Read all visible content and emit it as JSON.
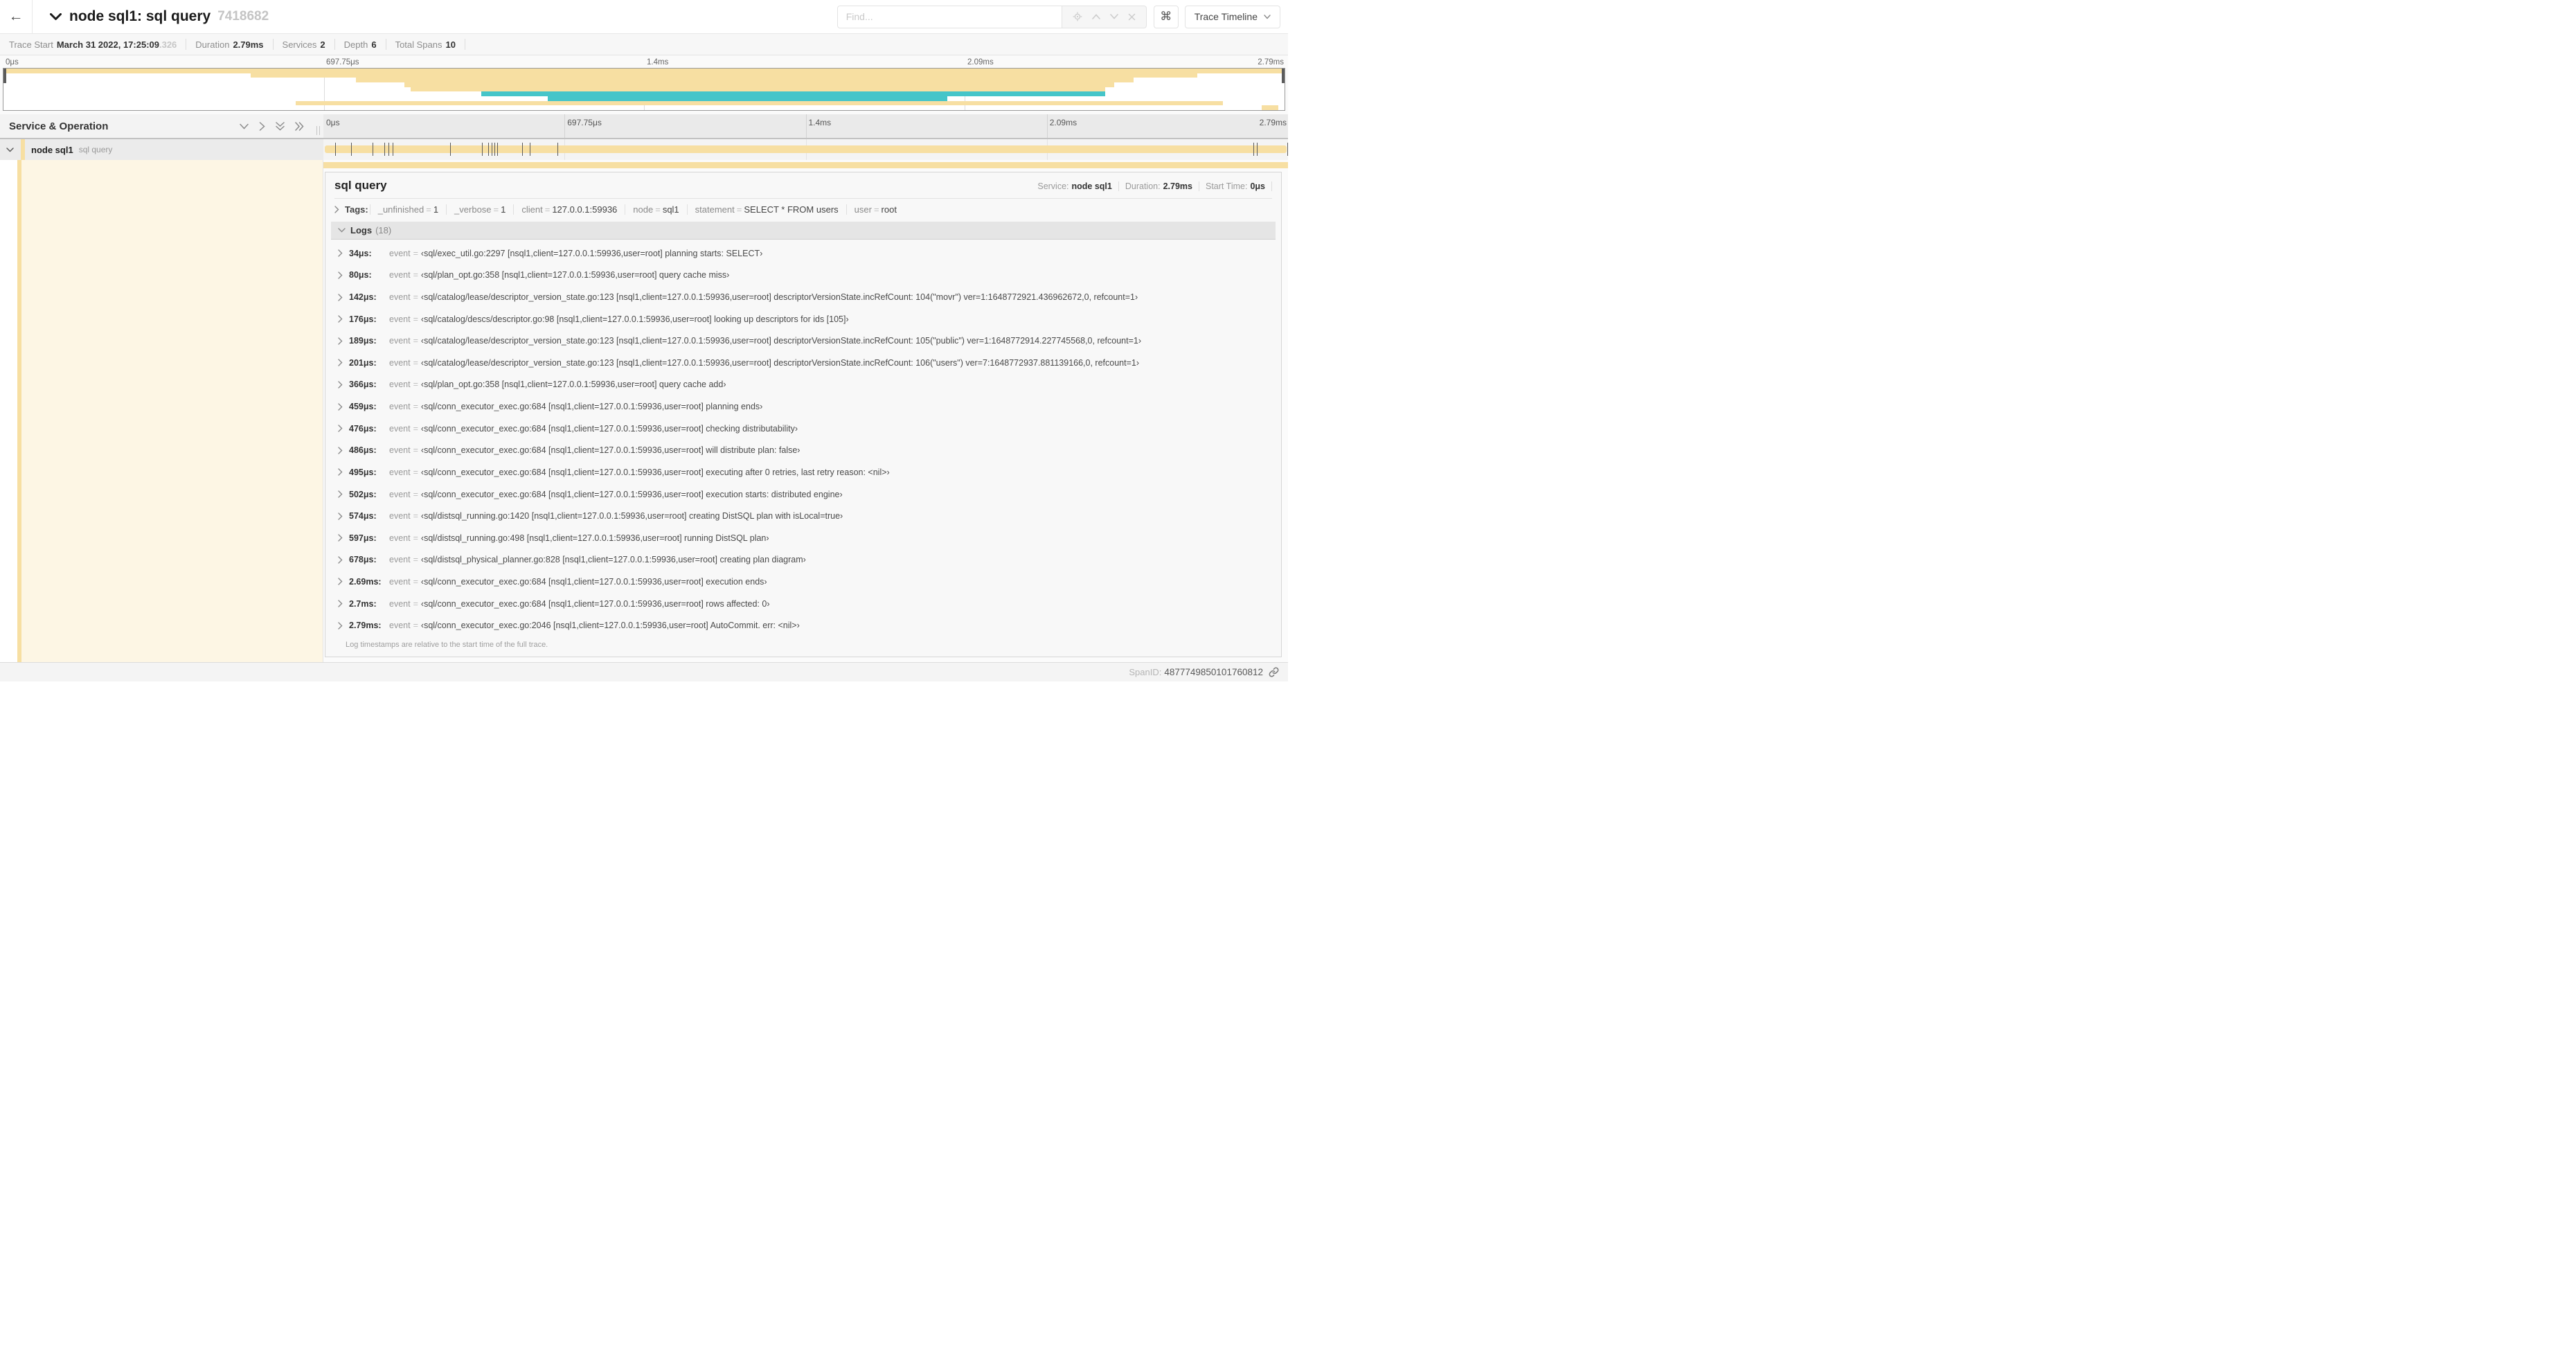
{
  "header": {
    "back_icon": "←",
    "title": "node sql1: sql query",
    "trace_id": "7418682",
    "find_placeholder": "Find...",
    "shortcut_key": "⌘",
    "view_button": "Trace Timeline"
  },
  "trace_info": [
    {
      "label": "Trace Start",
      "value": "March 31 2022, 17:25:09",
      "suffix": ".326"
    },
    {
      "label": "Duration",
      "value": "2.79ms",
      "suffix": ""
    },
    {
      "label": "Services",
      "value": "2",
      "suffix": ""
    },
    {
      "label": "Depth",
      "value": "6",
      "suffix": ""
    },
    {
      "label": "Total Spans",
      "value": "10",
      "suffix": ""
    }
  ],
  "timeline": {
    "duration_label": "2.79ms",
    "ticks": [
      {
        "label": "0μs",
        "pos": "0%",
        "align": "left"
      },
      {
        "label": "697.75μs",
        "pos": "25%",
        "align": "left"
      },
      {
        "label": "1.4ms",
        "pos": "50%",
        "align": "left"
      },
      {
        "label": "2.09ms",
        "pos": "75%",
        "align": "left"
      },
      {
        "label": "2.79ms",
        "pos": "100%",
        "align": "right"
      }
    ]
  },
  "colors": {
    "span_tan": "#f7dfa2",
    "span_teal": "#45c5c9",
    "expanded_cream": "#fdf6e4"
  },
  "minimap": {
    "bars": [
      {
        "top": "0%",
        "left": "0%",
        "width": "100%",
        "color": "#f7dfa2"
      },
      {
        "top": "11.11%",
        "left": "19.3%",
        "width": "73.9%",
        "color": "#f7dfa2"
      },
      {
        "top": "22.22%",
        "left": "27.5%",
        "width": "60.7%",
        "color": "#f7dfa2"
      },
      {
        "top": "33.33%",
        "left": "31.3%",
        "width": "55.4%",
        "color": "#f7dfa2"
      },
      {
        "top": "44.44%",
        "left": "31.8%",
        "width": "54.2%",
        "color": "#f7dfa2"
      },
      {
        "top": "55.56%",
        "left": "37.3%",
        "width": "48.7%",
        "color": "#45c5c9"
      },
      {
        "top": "66.67%",
        "left": "42.5%",
        "width": "31.2%",
        "color": "#45c5c9"
      },
      {
        "top": "77.78%",
        "left": "22.8%",
        "width": "72.4%",
        "color": "#f7dfa2"
      },
      {
        "top": "88.89%",
        "left": "98.2%",
        "width": "1.3%",
        "color": "#f7dfa2"
      }
    ]
  },
  "columns": {
    "left_header": "Service & Operation"
  },
  "span_row": {
    "service": "node sql1",
    "operation": "sql query"
  },
  "detail": {
    "operation": "sql query",
    "summary": [
      {
        "label": "Service:",
        "value": "node sql1"
      },
      {
        "label": "Duration:",
        "value": "2.79ms"
      },
      {
        "label": "Start Time:",
        "value": "0μs"
      }
    ],
    "tags_title": "Tags:",
    "tags": [
      {
        "key": "_unfinished",
        "value": "1"
      },
      {
        "key": "_verbose",
        "value": "1"
      },
      {
        "key": "client",
        "value": "127.0.0.1:59936"
      },
      {
        "key": "node",
        "value": "sql1"
      },
      {
        "key": "statement",
        "value": "SELECT * FROM users"
      },
      {
        "key": "user",
        "value": "root"
      }
    ],
    "logs_title": "Logs",
    "logs_count": "(18)",
    "logs": [
      {
        "time": "34μs:",
        "pct": "1.22%",
        "field": "event",
        "value": "‹sql/exec_util.go:2297 [nsql1,client=127.0.0.1:59936,user=root] planning starts: SELECT›"
      },
      {
        "time": "80μs:",
        "pct": "2.87%",
        "field": "event",
        "value": "‹sql/plan_opt.go:358 [nsql1,client=127.0.0.1:59936,user=root] query cache miss›"
      },
      {
        "time": "142μs:",
        "pct": "5.09%",
        "field": "event",
        "value": "‹sql/catalog/lease/descriptor_version_state.go:123 [nsql1,client=127.0.0.1:59936,user=root] descriptorVersionState.incRefCount: 104(\"movr\") ver=1:1648772921.436962672,0, refcount=1›"
      },
      {
        "time": "176μs:",
        "pct": "6.31%",
        "field": "event",
        "value": "‹sql/catalog/descs/descriptor.go:98 [nsql1,client=127.0.0.1:59936,user=root] looking up descriptors for ids [105]›"
      },
      {
        "time": "189μs:",
        "pct": "6.77%",
        "field": "event",
        "value": "‹sql/catalog/lease/descriptor_version_state.go:123 [nsql1,client=127.0.0.1:59936,user=root] descriptorVersionState.incRefCount: 105(\"public\") ver=1:1648772914.227745568,0, refcount=1›"
      },
      {
        "time": "201μs:",
        "pct": "7.20%",
        "field": "event",
        "value": "‹sql/catalog/lease/descriptor_version_state.go:123 [nsql1,client=127.0.0.1:59936,user=root] descriptorVersionState.incRefCount: 106(\"users\") ver=7:1648772937.881139166,0, refcount=1›"
      },
      {
        "time": "366μs:",
        "pct": "13.12%",
        "field": "event",
        "value": "‹sql/plan_opt.go:358 [nsql1,client=127.0.0.1:59936,user=root] query cache add›"
      },
      {
        "time": "459μs:",
        "pct": "16.45%",
        "field": "event",
        "value": "‹sql/conn_executor_exec.go:684 [nsql1,client=127.0.0.1:59936,user=root] planning ends›"
      },
      {
        "time": "476μs:",
        "pct": "17.06%",
        "field": "event",
        "value": "‹sql/conn_executor_exec.go:684 [nsql1,client=127.0.0.1:59936,user=root] checking distributability›"
      },
      {
        "time": "486μs:",
        "pct": "17.42%",
        "field": "event",
        "value": "‹sql/conn_executor_exec.go:684 [nsql1,client=127.0.0.1:59936,user=root] will distribute plan: false›"
      },
      {
        "time": "495μs:",
        "pct": "17.74%",
        "field": "event",
        "value": "‹sql/conn_executor_exec.go:684 [nsql1,client=127.0.0.1:59936,user=root] executing after 0 retries, last retry reason: <nil>›"
      },
      {
        "time": "502μs:",
        "pct": "17.99%",
        "field": "event",
        "value": "‹sql/conn_executor_exec.go:684 [nsql1,client=127.0.0.1:59936,user=root] execution starts: distributed engine›"
      },
      {
        "time": "574μs:",
        "pct": "20.57%",
        "field": "event",
        "value": "‹sql/distsql_running.go:1420 [nsql1,client=127.0.0.1:59936,user=root] creating DistSQL plan with isLocal=true›"
      },
      {
        "time": "597μs:",
        "pct": "21.40%",
        "field": "event",
        "value": "‹sql/distsql_running.go:498 [nsql1,client=127.0.0.1:59936,user=root] running DistSQL plan›"
      },
      {
        "time": "678μs:",
        "pct": "24.30%",
        "field": "event",
        "value": "‹sql/distsql_physical_planner.go:828 [nsql1,client=127.0.0.1:59936,user=root] creating plan diagram›"
      },
      {
        "time": "2.69ms:",
        "pct": "96.42%",
        "field": "event",
        "value": "‹sql/conn_executor_exec.go:684 [nsql1,client=127.0.0.1:59936,user=root] execution ends›"
      },
      {
        "time": "2.7ms:",
        "pct": "96.77%",
        "field": "event",
        "value": "‹sql/conn_executor_exec.go:684 [nsql1,client=127.0.0.1:59936,user=root] rows affected: 0›"
      },
      {
        "time": "2.79ms:",
        "pct": "99.9%",
        "field": "event",
        "value": "‹sql/conn_executor_exec.go:2046 [nsql1,client=127.0.0.1:59936,user=root] AutoCommit. err: <nil>›"
      }
    ],
    "note": "Log timestamps are relative to the start time of the full trace.",
    "footer_label": "SpanID:",
    "footer_value": "4877749850101760812"
  }
}
